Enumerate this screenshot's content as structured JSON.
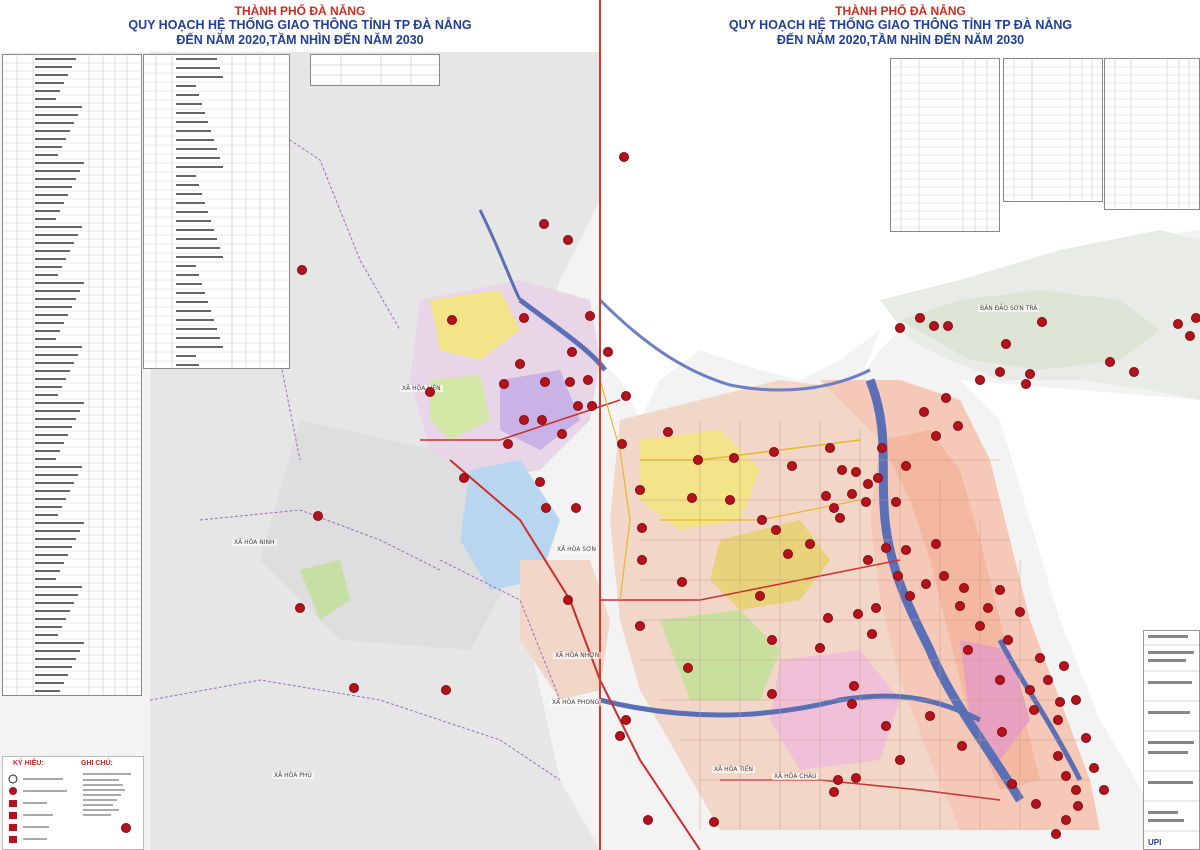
{
  "header": {
    "city": "THÀNH PHỐ ĐÀ NẴNG",
    "title_line1": "QUY HOẠCH HỆ THỐNG GIAO THÔNG TỈNH TP ĐÀ NẴNG",
    "title_line2": "ĐẾN NĂM 2020,TẦM NHÌN ĐẾN NĂM 2030"
  },
  "place_labels": {
    "hoa_lien": "XÃ HÒA LIÊN",
    "hoa_ninh": "XÃ HÒA NINH",
    "hoa_son": "XÃ HÒA SƠN",
    "hoa_nhon": "XÃ HÒA NHƠN",
    "hoa_phong": "XÃ HÒA PHONG",
    "hoa_phu": "XÃ HÒA PHÚ",
    "hoa_tien": "XÃ HÒA TIẾN",
    "hoa_chau": "XÃ HÒA CHÂU",
    "son_tra": "BÁN ĐẢO SƠN TRÀ"
  },
  "legend": {
    "title": "KÝ HIỆU:",
    "notes_title": "GHI CHÚ:"
  },
  "colors": {
    "accent_red": "#d32a1f",
    "title_blue": "#1f3f9a",
    "marker": "#b5121b",
    "sea": "#ffffff",
    "river": "#5a6fb5"
  }
}
